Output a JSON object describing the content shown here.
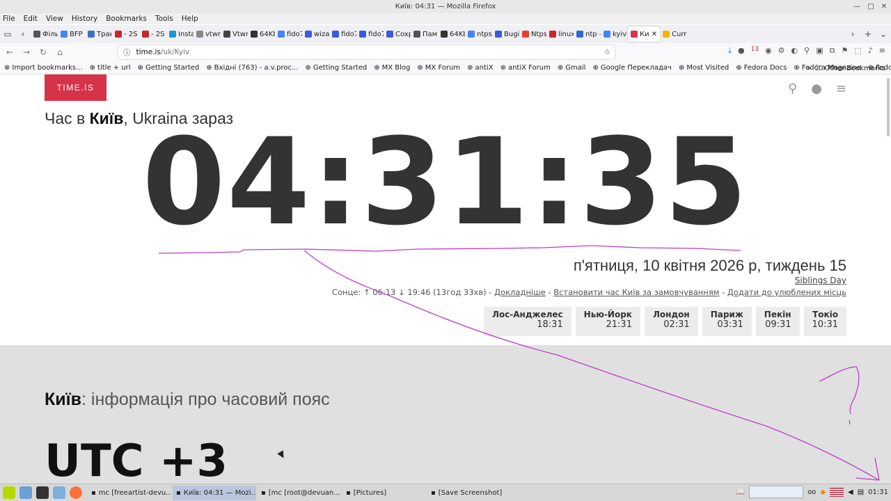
{
  "window": {
    "title": "Київ: 04:31 — Mozilla Firefox"
  },
  "menu": [
    "File",
    "Edit",
    "View",
    "History",
    "Bookmarks",
    "Tools",
    "Help"
  ],
  "tabs": [
    {
      "label": "Філь",
      "color": "#555"
    },
    {
      "label": "BFP",
      "color": "#4285f4"
    },
    {
      "label": "Тран",
      "color": "#3b73c4"
    },
    {
      "label": "- 2S",
      "color": "#c62828"
    },
    {
      "label": "- 2S",
      "color": "#c62828"
    },
    {
      "label": "Insta",
      "color": "#1c9ad6"
    },
    {
      "label": "vtwm | v",
      "color": "#888"
    },
    {
      "label": "Vtwn",
      "color": "#444"
    },
    {
      "label": "64Kb",
      "color": "#333"
    },
    {
      "label": "fido7",
      "color": "#4285f4"
    },
    {
      "label": "wiza",
      "color": "#3b5bdb"
    },
    {
      "label": "fido7",
      "color": "#3b5bdb"
    },
    {
      "label": "fido7",
      "color": "#3b5bdb"
    },
    {
      "label": "Coxp",
      "color": "#3b5bdb"
    },
    {
      "label": "Пам",
      "color": "#555"
    },
    {
      "label": "64Kb",
      "color": "#333"
    },
    {
      "label": "ntps",
      "color": "#4285f4"
    },
    {
      "label": "Bugi",
      "color": "#3b5bdb"
    },
    {
      "label": "Ntps",
      "color": "#e24329"
    },
    {
      "label": "linux",
      "color": "#c62828"
    },
    {
      "label": "ntp –",
      "color": "#3367d6"
    },
    {
      "label": "kyiv",
      "color": "#4285f4"
    },
    {
      "label": "Ки",
      "color": "#d6334a",
      "active": true
    },
    {
      "label": "Curr",
      "color": "#f5b400"
    }
  ],
  "url": {
    "host": "time.is",
    "path": "/uk/Kyiv"
  },
  "bookmarks": [
    "Import bookmarks...",
    "title + url",
    "Getting Started",
    "Вхідні (763) - a.v.proc...",
    "Getting Started",
    "MX Blog",
    "MX Forum",
    "antiX",
    "antiX Forum",
    "Gmail",
    "Google Перекладач",
    "Most Visited",
    "Fedora Docs",
    "Fedora Magazine",
    "Fedora Project"
  ],
  "bookmarks_other": "Other Bookmarks",
  "page": {
    "logo": "TIME.IS",
    "headline_pre": "Час в ",
    "headline_city": "Київ",
    "headline_post": ", Ukraina зараз",
    "clock": "04:31:35",
    "date": "п'ятниця, 10 квітня 2026 р, тиждень 15",
    "day_name": "Siblings Day",
    "sun": "Сонце: ↑ 06:13 ↓ 19:46 (13год 33хв)",
    "link_more": "Докладніше",
    "link_default": "Встановити час Київ за замовчуванням",
    "link_fav": "Додати до улюблених місць",
    "sep": " - ",
    "cities": [
      {
        "name": "Лос-Анджелес",
        "time": "18:31"
      },
      {
        "name": "Нью-Йорк",
        "time": "21:31"
      },
      {
        "name": "Лондон",
        "time": "02:31"
      },
      {
        "name": "Париж",
        "time": "03:31"
      },
      {
        "name": "Пекін",
        "time": "09:31"
      },
      {
        "name": "Токіо",
        "time": "10:31"
      }
    ],
    "info_city": "Київ",
    "info_rest": ": інформація про часовий пояс",
    "utc": "UTC +3"
  },
  "taskbar": {
    "tasks": [
      {
        "label": "mc [freeartist-devu...",
        "active": false
      },
      {
        "label": "Київ: 04:31 — Mozi...",
        "active": true
      },
      {
        "label": "[mc [root@devuan...",
        "active": false
      },
      {
        "label": "[Pictures]",
        "active": false
      },
      {
        "label": "[Save Screenshot]",
        "active": false
      }
    ],
    "clock": "01:31",
    "badge": "13"
  },
  "colors": {
    "brand": "#d6334a",
    "annotation": "#c03cc9"
  }
}
